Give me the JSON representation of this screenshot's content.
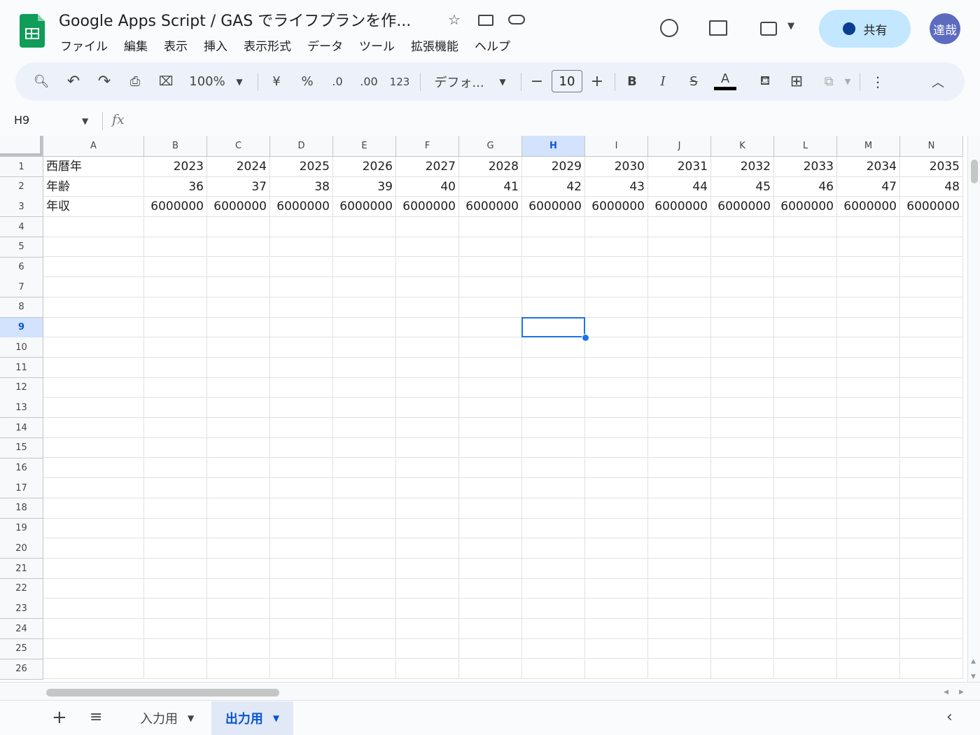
{
  "header": {
    "title": "Google Apps Script / GAS でライフプランを作...",
    "menu": [
      "ファイル",
      "編集",
      "表示",
      "挿入",
      "表示形式",
      "データ",
      "ツール",
      "拡張機能",
      "ヘルプ"
    ],
    "share_label": "共有",
    "avatar_text": "達哉"
  },
  "toolbar": {
    "zoom": "100%",
    "currency": "¥",
    "percent": "%",
    "decrease_decimal": ".0",
    "increase_decimal": ".00",
    "number_format": "123",
    "font": "デフォ...",
    "font_size": "10",
    "bold": "B",
    "italic": "I",
    "strike": "S",
    "text_color": "A"
  },
  "formula_bar": {
    "cell_ref": "H9",
    "fx": "fx"
  },
  "grid": {
    "columns": [
      "A",
      "B",
      "C",
      "D",
      "E",
      "F",
      "G",
      "H",
      "I",
      "J",
      "K",
      "L",
      "M",
      "N"
    ],
    "selected_column": "H",
    "selected_row": 9,
    "row_count": 26,
    "rows": [
      [
        "西暦年",
        "2023",
        "2024",
        "2025",
        "2026",
        "2027",
        "2028",
        "2029",
        "2030",
        "2031",
        "2032",
        "2033",
        "2034",
        "2035"
      ],
      [
        "年齢",
        "36",
        "37",
        "38",
        "39",
        "40",
        "41",
        "42",
        "43",
        "44",
        "45",
        "46",
        "47",
        "48"
      ],
      [
        "年収",
        "6000000",
        "6000000",
        "6000000",
        "6000000",
        "6000000",
        "6000000",
        "6000000",
        "6000000",
        "6000000",
        "6000000",
        "6000000",
        "6000000",
        "6000000"
      ]
    ]
  },
  "sheets": {
    "tabs": [
      "入力用",
      "出力用"
    ],
    "active": "出力用"
  },
  "colors": {
    "accent": "#1a73e8",
    "share_bg": "#c2e7ff",
    "sheets_green": "#0f9d58"
  }
}
